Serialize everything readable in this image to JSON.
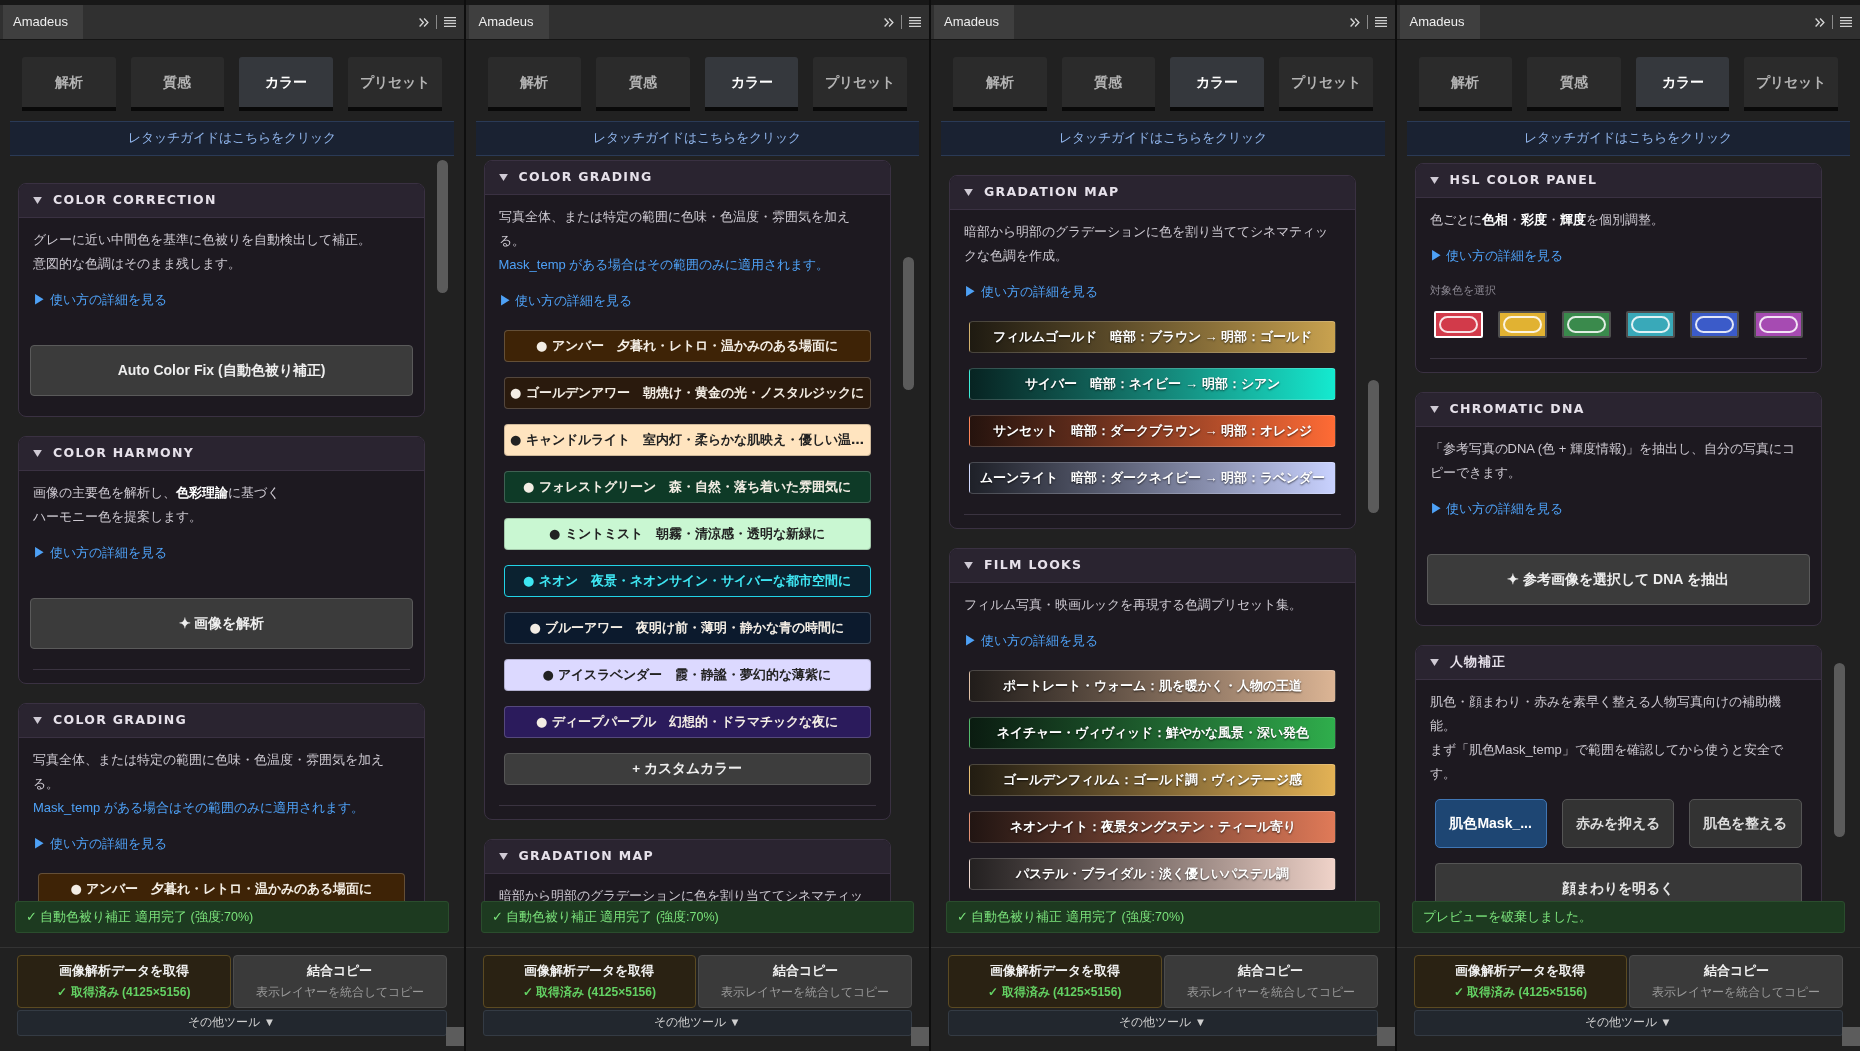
{
  "panels": [
    {
      "title": "Amadeus",
      "tabs": [
        {
          "label": "解析",
          "selected": false
        },
        {
          "label": "質感",
          "selected": false
        },
        {
          "label": "カラー",
          "selected": true
        },
        {
          "label": "プリセット",
          "selected": false
        }
      ],
      "guide_link": "レタッチガイドはこちらをクリック",
      "sections": [
        {
          "title": "COLOR CORRECTION",
          "expanded": true,
          "paragraphs": [
            {
              "kind": "plain",
              "text": "グレーに近い中間色を基準に色被りを自動検出して補正。"
            },
            {
              "kind": "plain",
              "text": "意図的な色調はそのまま残します。"
            }
          ],
          "help_link": "▶ 使い方の詳細を見る",
          "controls": [
            {
              "kind": "action",
              "label": "Auto Color Fix (自動色被り補正)"
            }
          ],
          "divider": false
        },
        {
          "title": "COLOR HARMONY",
          "expanded": true,
          "paragraphs": [
            {
              "kind": "plain",
              "text": "画像の主要色を解析し、**色彩理論**に基づく"
            },
            {
              "kind": "plain",
              "text": "ハーモニー色を提案します。"
            }
          ],
          "help_link": "▶ 使い方の詳細を見る",
          "controls": [
            {
              "kind": "action",
              "label": "✦ 画像を解析"
            }
          ],
          "divider": true
        },
        {
          "title": "COLOR GRADING",
          "expanded": true,
          "paragraphs": [
            {
              "kind": "plain",
              "text": "写真全体、または特定の範囲に色味・色温度・雰囲気を加える。"
            },
            {
              "kind": "note",
              "text": "Mask_temp がある場合はその範囲のみに適用されます。"
            }
          ],
          "help_link": "▶ 使い方の詳細を見る",
          "controls": [
            {
              "kind": "dark_preset",
              "label": "● アンバー　夕暮れ・レトロ・温かみのある場面に",
              "color": "#3e2306"
            }
          ],
          "divider": false
        }
      ],
      "status": "✓ 自動色被り補正 適用完了 (強度:70%)",
      "footer_buttons": [
        {
          "kind": "fetch",
          "title": "画像解析データを取得",
          "subtitle": "✓ 取得済み (4125×5156)"
        },
        {
          "kind": "copy",
          "title": "結合コピー",
          "subtitle": "表示レイヤーを統合してコピー"
        }
      ],
      "more_tools": "その他ツール ▼"
    },
    {
      "title": "Amadeus",
      "tabs": [
        {
          "label": "解析",
          "selected": false
        },
        {
          "label": "質感",
          "selected": false
        },
        {
          "label": "カラー",
          "selected": true
        },
        {
          "label": "プリセット",
          "selected": false
        }
      ],
      "guide_link": "レタッチガイドはこちらをクリック",
      "sections": [
        {
          "title": "COLOR GRADING",
          "expanded": true,
          "paragraphs": [
            {
              "kind": "plain",
              "text": "写真全体、または特定の範囲に色味・色温度・雰囲気を加える。"
            },
            {
              "kind": "note",
              "text": "Mask_temp がある場合はその範囲のみに適用されます。"
            }
          ],
          "help_link": "▶ 使い方の詳細を見る",
          "controls": [
            {
              "kind": "dark_preset",
              "label": "● アンバー　夕暮れ・レトロ・温かみのある場面に",
              "color": "#3e2306"
            },
            {
              "kind": "dark_preset",
              "label": "● ゴールデンアワー　朝焼け・黄金の光・ノスタルジックに",
              "color": "#2a1a0d"
            },
            {
              "kind": "light_preset",
              "label": "● キャンドルライト　室内灯・柔らかな肌映え・優しい温…",
              "color": "#ffe4bf"
            },
            {
              "kind": "dark_preset",
              "label": "● フォレストグリーン　森・自然・落ち着いた雰囲気に",
              "color": "#0e3a27"
            },
            {
              "kind": "light_preset",
              "label": "● ミントミスト　朝霧・清涼感・透明な新緑に",
              "color": "#c9f7d2"
            },
            {
              "kind": "neon_preset",
              "label": "● ネオン　夜景・ネオンサイン・サイバーな都市空間に",
              "color": "#0b2230"
            },
            {
              "kind": "dark_preset",
              "label": "● ブルーアワー　夜明け前・薄明・静かな青の時間に",
              "color": "#0c1a2d"
            },
            {
              "kind": "light_preset",
              "label": "● アイスラベンダー　霞・静謐・夢幻的な薄紫に",
              "color": "#dcd9ff"
            },
            {
              "kind": "dark_preset",
              "label": "● ディープパープル　幻想的・ドラマチックな夜に",
              "color": "#2b1b5c"
            },
            {
              "kind": "custom",
              "label": "+ カスタムカラー"
            }
          ],
          "divider": true
        },
        {
          "title": "GRADATION MAP",
          "expanded": true,
          "paragraphs": [
            {
              "kind": "plain",
              "text": "暗部から明部のグラデーションに色を割り当ててシネマティッ"
            }
          ],
          "divider": false
        }
      ],
      "status": "✓ 自動色被り補正 適用完了 (強度:70%)",
      "footer_buttons": [
        {
          "kind": "fetch",
          "title": "画像解析データを取得",
          "subtitle": "✓ 取得済み (4125×5156)"
        },
        {
          "kind": "copy",
          "title": "結合コピー",
          "subtitle": "表示レイヤーを統合してコピー"
        }
      ],
      "more_tools": "その他ツール ▼"
    },
    {
      "title": "Amadeus",
      "tabs": [
        {
          "label": "解析",
          "selected": false
        },
        {
          "label": "質感",
          "selected": false
        },
        {
          "label": "カラー",
          "selected": true
        },
        {
          "label": "プリセット",
          "selected": false
        }
      ],
      "guide_link": "レタッチガイドはこちらをクリック",
      "sections": [
        {
          "title": "GRADATION MAP",
          "expanded": true,
          "paragraphs": [
            {
              "kind": "plain",
              "text": "暗部から明部のグラデーションに色を割り当ててシネマティックな色調を作成。"
            }
          ],
          "help_link": "▶ 使い方の詳細を見る",
          "controls": [
            {
              "kind": "gradient",
              "label": "フィルムゴールド　暗部：ブラウン → 明部：ゴールド",
              "color": "#c9a24f"
            },
            {
              "kind": "gradient",
              "label": "サイバー　暗部：ネイビー → 明部：シアン",
              "color": "#14ead0"
            },
            {
              "kind": "gradient",
              "label": "サンセット　暗部：ダークブラウン → 明部：オレンジ",
              "color": "#ff6b35"
            },
            {
              "kind": "gradient",
              "label": "ムーンライト　暗部：ダークネイビー → 明部：ラベンダー",
              "color": "#c9d2ff"
            }
          ],
          "divider": true
        },
        {
          "title": "FILM LOOKS",
          "expanded": true,
          "paragraphs": [
            {
              "kind": "plain",
              "text": "フィルム写真・映画ルックを再現する色調プリセット集。"
            }
          ],
          "help_link": "▶ 使い方の詳細を見る",
          "controls": [
            {
              "kind": "gradient",
              "label": "ポートレート・ウォーム：肌を暖かく・人物の王道",
              "color": "#dcb595"
            },
            {
              "kind": "gradient",
              "label": "ネイチャー・ヴィヴィッド：鮮やかな風景・深い発色",
              "color": "#2fae4c"
            },
            {
              "kind": "gradient",
              "label": "ゴールデンフィルム：ゴールド調・ヴィンテージ感",
              "color": "#e3b255"
            },
            {
              "kind": "gradient",
              "label": "ネオンナイト：夜景タングステン・ティール寄り",
              "color": "#e07a58"
            },
            {
              "kind": "gradient",
              "label": "パステル・ブライダル：淡く優しいパステル調",
              "color": "#f0d3c9"
            }
          ],
          "divider": false
        }
      ],
      "status": "✓ 自動色被り補正 適用完了 (強度:70%)",
      "footer_buttons": [
        {
          "kind": "fetch",
          "title": "画像解析データを取得",
          "subtitle": "✓ 取得済み (4125×5156)"
        },
        {
          "kind": "copy",
          "title": "結合コピー",
          "subtitle": "表示レイヤーを統合してコピー"
        }
      ],
      "more_tools": "その他ツール ▼"
    },
    {
      "title": "Amadeus",
      "tabs": [
        {
          "label": "解析",
          "selected": false
        },
        {
          "label": "質感",
          "selected": false
        },
        {
          "label": "カラー",
          "selected": true
        },
        {
          "label": "プリセット",
          "selected": false
        }
      ],
      "guide_link": "レタッチガイドはこちらをクリック",
      "sections": [
        {
          "title": "HSL COLOR PANEL",
          "expanded": true,
          "paragraphs": [
            {
              "kind": "plain",
              "text": "色ごとに**色相**・**彩度**・**輝度**を個別調整。"
            }
          ],
          "help_link": "▶ 使い方の詳細を見る",
          "controls": [
            {
              "kind": "swatches",
              "label": "対象色を選択",
              "swatches": [
                {
                  "color": "#d23a4a",
                  "selected": true
                },
                {
                  "color": "#e1b232",
                  "selected": false
                },
                {
                  "color": "#3a8a4c",
                  "selected": false
                },
                {
                  "color": "#39a9b9",
                  "selected": false
                },
                {
                  "color": "#3b5bc9",
                  "selected": false
                },
                {
                  "color": "#a64bb2",
                  "selected": false
                }
              ]
            }
          ],
          "divider": true
        },
        {
          "title": "CHROMATIC DNA",
          "expanded": true,
          "paragraphs": [
            {
              "kind": "plain",
              "text": "「参考写真のDNA (色 + 輝度情報)」を抽出し、自分の写真にコピーできます。"
            }
          ],
          "help_link": "▶ 使い方の詳細を見る",
          "controls": [
            {
              "kind": "action",
              "label": "✦ 参考画像を選択して DNA を抽出"
            }
          ],
          "divider": false
        },
        {
          "title": "人物補正",
          "expanded": true,
          "paragraphs": [
            {
              "kind": "plain",
              "text": "肌色・顔まわり・赤みを素早く整える人物写真向けの補助機能。"
            },
            {
              "kind": "plain",
              "text": "まず「肌色Mask_temp」で範囲を確認してから使うと安全です。"
            }
          ],
          "controls": [
            {
              "kind": "button_group",
              "buttons": [
                {
                  "label": "肌色Mask_...",
                  "selected": true
                },
                {
                  "label": "赤みを抑える",
                  "selected": false
                },
                {
                  "label": "肌色を整える",
                  "selected": false
                }
              ]
            },
            {
              "kind": "wide_action",
              "label": "顔まわりを明るく"
            }
          ],
          "divider": false
        }
      ],
      "status": "プレビューを破棄しました。",
      "footer_buttons": [
        {
          "kind": "fetch",
          "title": "画像解析データを取得",
          "subtitle": "✓ 取得済み (4125×5156)"
        },
        {
          "kind": "copy",
          "title": "結合コピー",
          "subtitle": "表示レイヤーを統合してコピー"
        }
      ],
      "more_tools": "その他ツール ▼"
    }
  ]
}
